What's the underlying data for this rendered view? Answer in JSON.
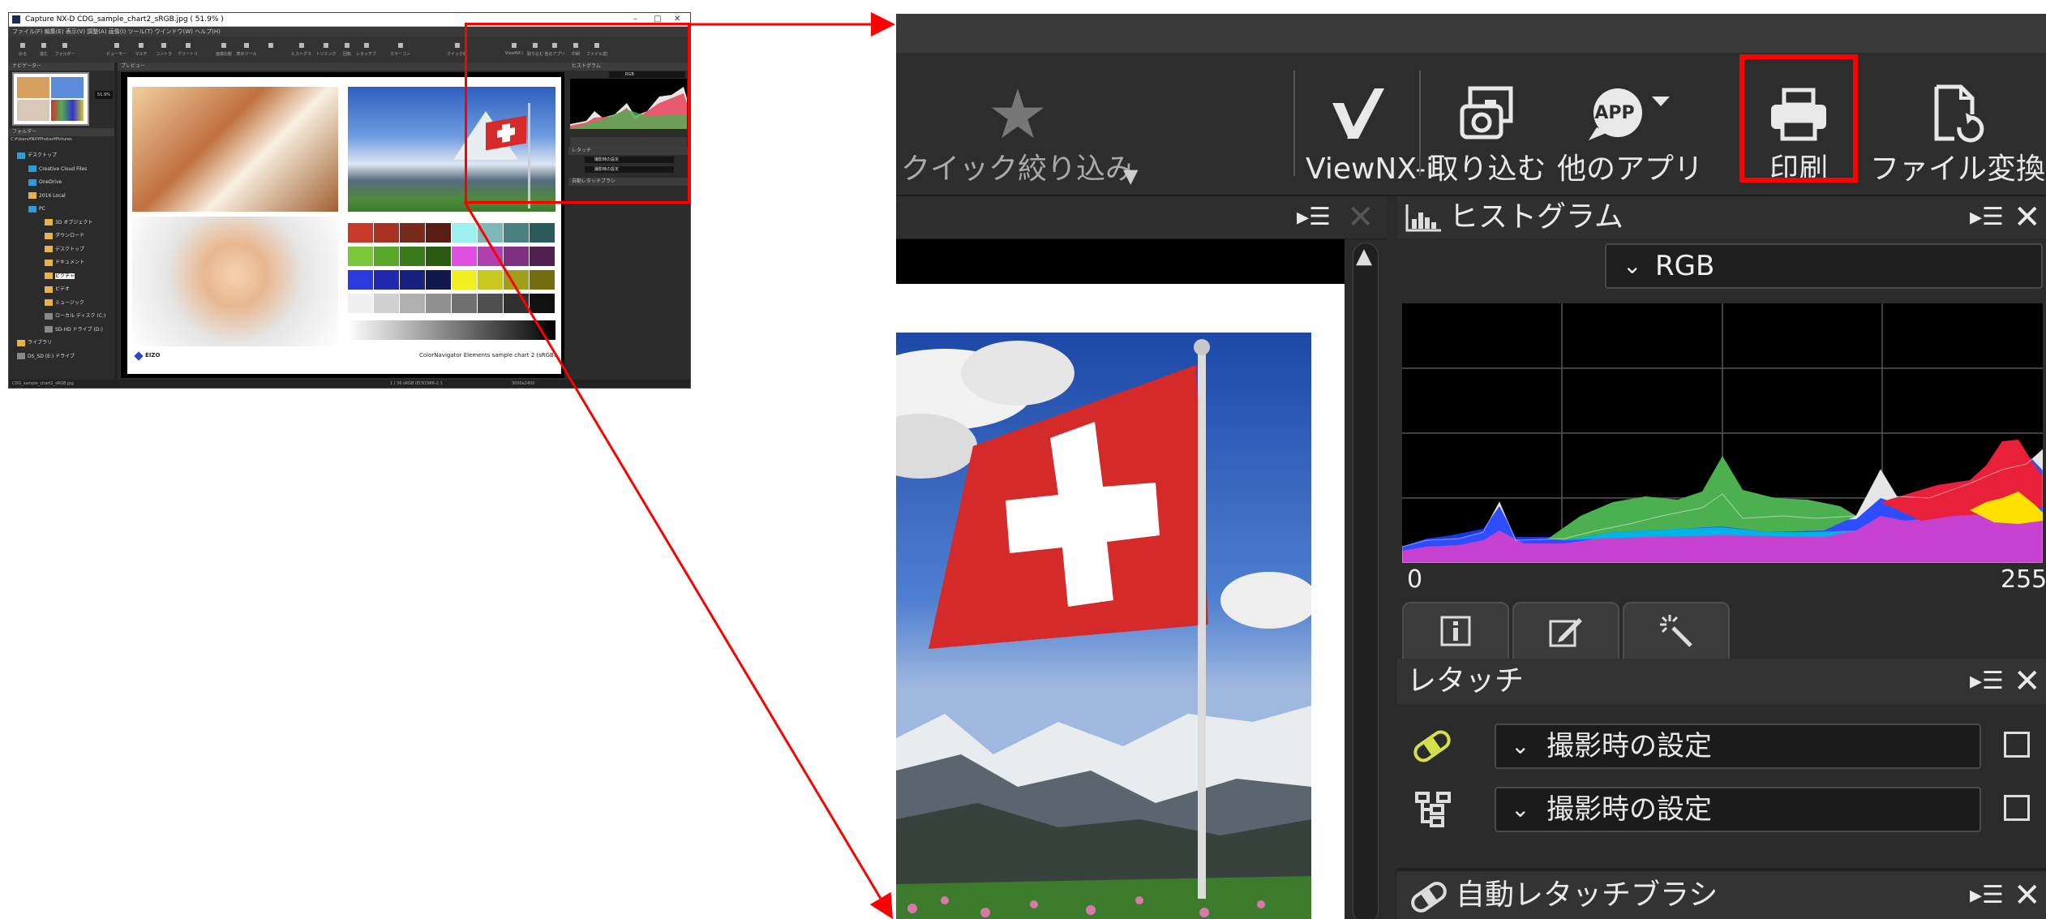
{
  "small": {
    "title": "Capture NX-D    CDG_sample_chart2_sRGB.jpg ( 51.9% )",
    "menu": "ファイル(F)  編集(E)  表示(V)  調整(A)  画像(I)  ツール(T)  ウインドウ(W)  ヘルプ(H)",
    "toolbar": [
      "戻る",
      "進む",
      "フォルダー",
      "ビューモード",
      "マルチ",
      "コントラ",
      "デリートリスト",
      "画像比較",
      "表示ツール",
      "",
      "ヒストグラム",
      "トリミング",
      "回転",
      "レタッチブラシ",
      "カラーコントロールポイント",
      "クイック絞り込み",
      "ViewNX-i",
      "取り込む",
      "他のアプリ",
      "印刷",
      "ファイル変換"
    ],
    "navigator_label": "ナビゲーター",
    "zoom_value": "51.9%",
    "folder_label": "フォルダー",
    "preview_label": "プレビュー",
    "folder_path": "C:¥Users¥NX¥Photos¥Pictures",
    "folders": [
      "デスクトップ",
      "Creative Cloud Files",
      "OneDrive",
      "2016 Local",
      "PC",
      "3D オブジェクト",
      "ダウンロード",
      "デスクトップ",
      "ドキュメント",
      "ピクチャ",
      "ビデオ",
      "ミュージック",
      "ローカル ディスク (C:)",
      "SD-HD ドライブ (D:)",
      "ライブラリ",
      "DS_SD (E:) ドライブ"
    ],
    "chart_caption": "ColorNavigator Elements sample chart 2 (sRGB)",
    "brand": "EIZO",
    "hist_title": "ヒストグラム",
    "hist_channel": "RGB",
    "retouch_title": "レタッチ",
    "retouch_value": "撮影時の設定",
    "auto_retouch_title": "自動レタッチブラシ",
    "status_left": "CDG_sample_chart2_sRGB.jpg",
    "status_mid": "1 / 36   sRGB IEC61966-2.1",
    "status_right": "3000x2400"
  },
  "zoom": {
    "tools": {
      "quick_filter": "クイック絞り込み",
      "viewnx": "ViewNX-i",
      "import": "取り込む",
      "other_apps": "他のアプリ",
      "other_apps_badge": "APP",
      "print": "印刷",
      "file_convert": "ファイル変換"
    },
    "histogram": {
      "title": "ヒストグラム",
      "channel": "RGB",
      "axis_min": "0",
      "axis_max": "255"
    },
    "retouch": {
      "title": "レタッチ",
      "row1_value": "撮影時の設定",
      "row2_value": "撮影時の設定"
    },
    "auto_retouch": {
      "title": "自動レタッチブラシ"
    },
    "panel_menu_glyph": "▸☰",
    "close_glyph": "✕"
  },
  "colors": {
    "highlight": "#ff0000",
    "panel_bg": "#2b2b2b",
    "hist_gray": "#e6e6e6",
    "hist_green": "#4caf50",
    "hist_blue": "#1a3cff",
    "hist_magenta": "#e040c8",
    "hist_red": "#e8203a",
    "hist_yellow": "#ffe000",
    "hist_cyan": "#00b4e6"
  }
}
